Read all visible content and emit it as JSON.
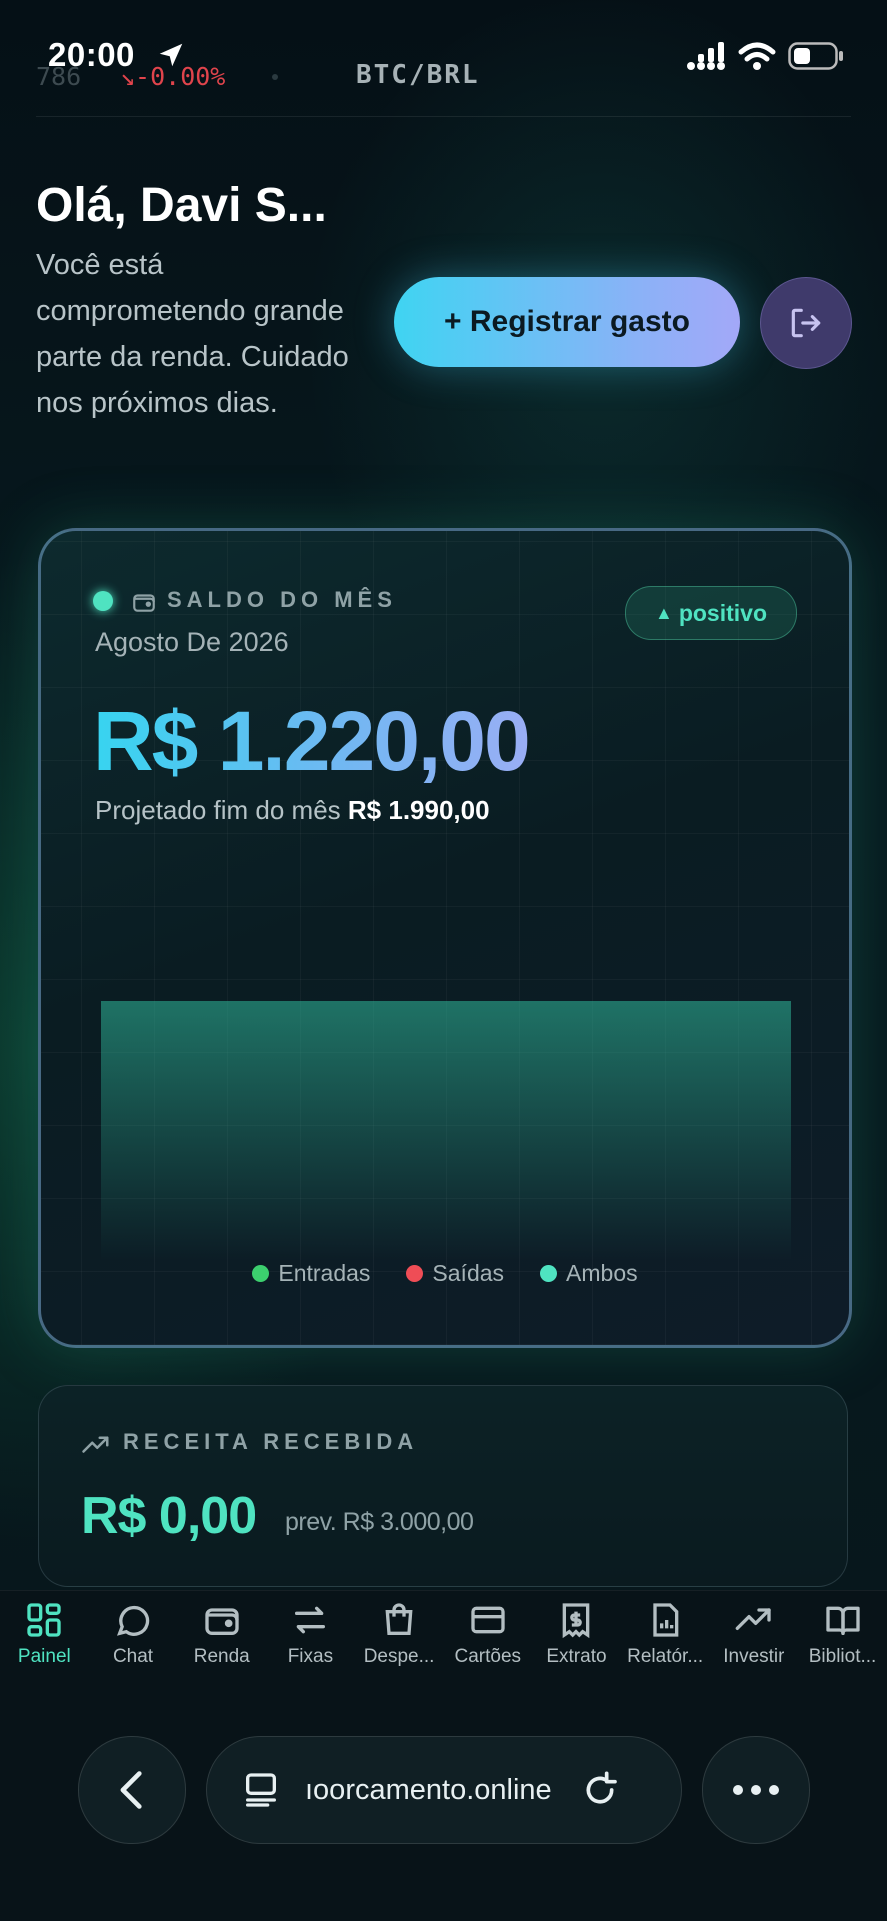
{
  "status": {
    "time": "20:00"
  },
  "ticker": {
    "prev_value": "786",
    "change": "↘-0.00%",
    "pair": "BTC/BRL"
  },
  "header": {
    "greeting": "Olá, Davi S...",
    "message": "Você está comprometendo grande parte da renda. Cuidado nos próximos dias.",
    "register_button": "+ Registrar gasto"
  },
  "balance_card": {
    "label": "SALDO DO MÊS",
    "period": "Agosto De 2026",
    "badge": "positivo",
    "amount": "R$ 1.220,00",
    "projected_label": "Projetado fim do mês",
    "projected_value": "R$ 1.990,00",
    "legend": [
      {
        "label": "Entradas",
        "color": "#3ccf6e"
      },
      {
        "label": "Saídas",
        "color": "#ef4d56"
      },
      {
        "label": "Ambos",
        "color": "#4fe3c1"
      }
    ]
  },
  "chart_data": {
    "type": "area",
    "series": [
      {
        "name": "Ambos",
        "values": [
          1220,
          1220
        ]
      }
    ],
    "x": [
      0,
      1
    ],
    "ylim": [
      0,
      1990
    ],
    "grid": true,
    "legend": "bottom"
  },
  "income_card": {
    "label": "RECEITA RECEBIDA",
    "value": "R$ 0,00",
    "expected": "prev. R$ 3.000,00"
  },
  "nav": {
    "items": [
      {
        "label": "Painel",
        "icon": "grid-icon",
        "active": true
      },
      {
        "label": "Chat",
        "icon": "chat-icon",
        "active": false
      },
      {
        "label": "Renda",
        "icon": "wallet-icon",
        "active": false
      },
      {
        "label": "Fixas",
        "icon": "repeat-icon",
        "active": false
      },
      {
        "label": "Despe...",
        "icon": "bag-icon",
        "active": false
      },
      {
        "label": "Cartões",
        "icon": "card-icon",
        "active": false
      },
      {
        "label": "Extrato",
        "icon": "receipt-icon",
        "active": false
      },
      {
        "label": "Relatór...",
        "icon": "report-icon",
        "active": false
      },
      {
        "label": "Investir",
        "icon": "trend-icon",
        "active": false
      },
      {
        "label": "Bibliot...",
        "icon": "book-icon",
        "active": false
      }
    ]
  },
  "browser": {
    "url": "ıoorcamento.online"
  },
  "colors": {
    "accent": "#4fe3c1",
    "negative": "#e0444c",
    "cta_start": "#3fd4f2",
    "cta_end": "#a3a8f8"
  }
}
